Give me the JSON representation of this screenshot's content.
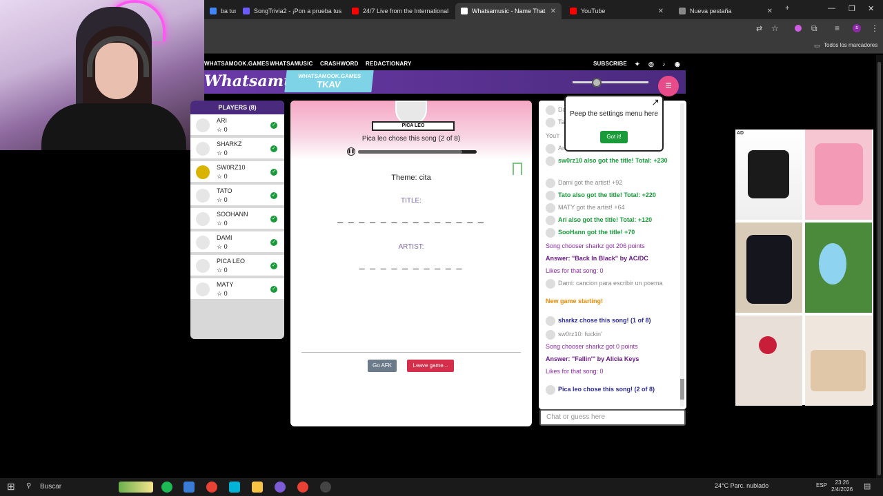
{
  "browser": {
    "tabs": [
      {
        "label": "ba tus",
        "color": "#4285f4"
      },
      {
        "label": "SongTrivia2 - ¡Pon a prueba tus",
        "color": "#6b5bff"
      },
      {
        "label": "24/7 Live from the International",
        "color": "#ff0000"
      },
      {
        "label": "Whatsamusic - Name That",
        "color": "#fff"
      },
      {
        "label": "YouTube",
        "color": "#ff0000"
      },
      {
        "label": "Nueva pestaña",
        "color": "#888"
      }
    ],
    "bookmarks_label": "Todos los marcadores"
  },
  "site": {
    "nav": [
      "WHATSAMOOK.GAMES",
      "WHATSAMUSIC",
      "CRASHWORD",
      "REDACTIONARY"
    ],
    "subscribe": "SUBSCRIBE",
    "logo": "Whatsamusic",
    "tag_top": "WHATSAMOOK.GAMES",
    "tag_room": "TKAV"
  },
  "players": {
    "header": "PLAYERS (8)",
    "list": [
      {
        "name": "ARI",
        "score": "0"
      },
      {
        "name": "SHARKZ",
        "score": "0"
      },
      {
        "name": "SW0RZ10",
        "score": "0"
      },
      {
        "name": "TATO",
        "score": "0"
      },
      {
        "name": "SOOHANN",
        "score": "0"
      },
      {
        "name": "DAMI",
        "score": "0"
      },
      {
        "name": "PICA LEO",
        "score": "0"
      },
      {
        "name": "MATY",
        "score": "0"
      }
    ]
  },
  "game": {
    "chooser": "PICA LEO",
    "chose_text": "Pica leo chose this song (2 of 8)",
    "progress": 0.88,
    "theme": "Theme: cita",
    "title_label": "TITLE:",
    "title_blanks": "_ _ _ _ _ _ _    _ _    _ _ _ _ _",
    "artist_label": "ARTIST:",
    "artist_blanks": "_ _ _    _ _ _ _ _ _ _",
    "afk_label": "Go AFK",
    "leave_label": "Leave game..."
  },
  "popup": {
    "text": "Peep the settings menu here",
    "button": "Got it!"
  },
  "chat": {
    "messages": [
      {
        "text": "Da",
        "cls": "grey",
        "icon": true
      },
      {
        "text": "Ta",
        "cls": "grey",
        "icon": true
      },
      {
        "text": "You'r",
        "cls": "grey",
        "icon": false
      },
      {
        "text": "Ari got the artist! +108",
        "cls": "grey",
        "icon": true
      },
      {
        "text": "sw0rz10 also got the title! Total: +230",
        "cls": "green",
        "icon": true
      },
      {
        "text": "Dami got the artist! +92",
        "cls": "grey",
        "icon": true
      },
      {
        "text": "Tato also got the title! Total: +220",
        "cls": "green",
        "icon": true
      },
      {
        "text": "MATY got the artist! +64",
        "cls": "grey",
        "icon": true
      },
      {
        "text": "Ari also got the title! Total: +120",
        "cls": "green",
        "icon": true
      },
      {
        "text": "SooHann got the title! +70",
        "cls": "green",
        "icon": true
      },
      {
        "text": "Song chooser sharkz got 206 points",
        "cls": "purple",
        "icon": false
      },
      {
        "text": "Answer: \"Back In Black\" by AC/DC",
        "cls": "purpleb",
        "icon": false
      },
      {
        "text": "Likes for that song: 0",
        "cls": "purple",
        "icon": false
      },
      {
        "text": "Dami: cancion para escribir un poema",
        "cls": "grey",
        "icon": true
      },
      {
        "text": "New game starting!",
        "cls": "orange",
        "icon": false
      },
      {
        "text": "sharkz chose this song! (1 of 8)",
        "cls": "navy",
        "icon": true
      },
      {
        "text": "sw0rz10: fuckin'",
        "cls": "grey",
        "icon": true
      },
      {
        "text": "Song chooser sharkz got 0 points",
        "cls": "purple",
        "icon": false
      },
      {
        "text": "Answer: \"Fallin'\" by Alicia Keys",
        "cls": "purpleb",
        "icon": false
      },
      {
        "text": "Likes for that song: 0",
        "cls": "purple",
        "icon": false
      },
      {
        "text": "Pica leo chose this song! (2 of 8)",
        "cls": "navy",
        "icon": true
      }
    ],
    "placeholder": "Chat or guess here"
  },
  "ad": {
    "label": "AD"
  },
  "taskbar": {
    "search": "Buscar",
    "weather": "24°C  Parc. nublado",
    "lang": "ESP",
    "time": "23:26",
    "date": "2/4/2026"
  }
}
